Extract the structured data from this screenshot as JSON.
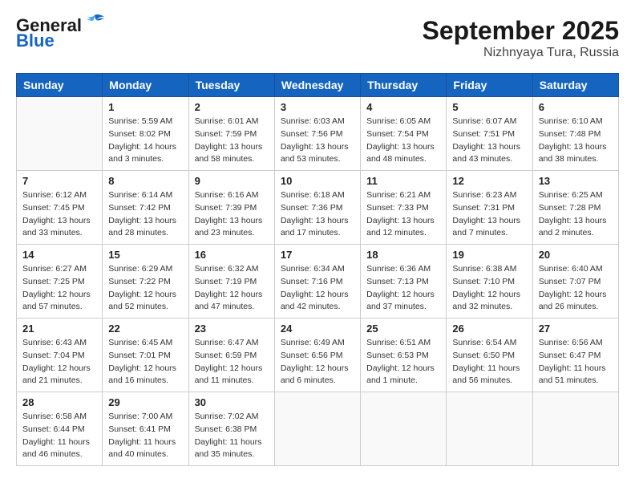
{
  "header": {
    "logo_line1": "General",
    "logo_line2": "Blue",
    "month": "September 2025",
    "location": "Nizhnyaya Tura, Russia"
  },
  "weekdays": [
    "Sunday",
    "Monday",
    "Tuesday",
    "Wednesday",
    "Thursday",
    "Friday",
    "Saturday"
  ],
  "weeks": [
    [
      {
        "day": "",
        "info": ""
      },
      {
        "day": "1",
        "info": "Sunrise: 5:59 AM\nSunset: 8:02 PM\nDaylight: 14 hours\nand 3 minutes."
      },
      {
        "day": "2",
        "info": "Sunrise: 6:01 AM\nSunset: 7:59 PM\nDaylight: 13 hours\nand 58 minutes."
      },
      {
        "day": "3",
        "info": "Sunrise: 6:03 AM\nSunset: 7:56 PM\nDaylight: 13 hours\nand 53 minutes."
      },
      {
        "day": "4",
        "info": "Sunrise: 6:05 AM\nSunset: 7:54 PM\nDaylight: 13 hours\nand 48 minutes."
      },
      {
        "day": "5",
        "info": "Sunrise: 6:07 AM\nSunset: 7:51 PM\nDaylight: 13 hours\nand 43 minutes."
      },
      {
        "day": "6",
        "info": "Sunrise: 6:10 AM\nSunset: 7:48 PM\nDaylight: 13 hours\nand 38 minutes."
      }
    ],
    [
      {
        "day": "7",
        "info": "Sunrise: 6:12 AM\nSunset: 7:45 PM\nDaylight: 13 hours\nand 33 minutes."
      },
      {
        "day": "8",
        "info": "Sunrise: 6:14 AM\nSunset: 7:42 PM\nDaylight: 13 hours\nand 28 minutes."
      },
      {
        "day": "9",
        "info": "Sunrise: 6:16 AM\nSunset: 7:39 PM\nDaylight: 13 hours\nand 23 minutes."
      },
      {
        "day": "10",
        "info": "Sunrise: 6:18 AM\nSunset: 7:36 PM\nDaylight: 13 hours\nand 17 minutes."
      },
      {
        "day": "11",
        "info": "Sunrise: 6:21 AM\nSunset: 7:33 PM\nDaylight: 13 hours\nand 12 minutes."
      },
      {
        "day": "12",
        "info": "Sunrise: 6:23 AM\nSunset: 7:31 PM\nDaylight: 13 hours\nand 7 minutes."
      },
      {
        "day": "13",
        "info": "Sunrise: 6:25 AM\nSunset: 7:28 PM\nDaylight: 13 hours\nand 2 minutes."
      }
    ],
    [
      {
        "day": "14",
        "info": "Sunrise: 6:27 AM\nSunset: 7:25 PM\nDaylight: 12 hours\nand 57 minutes."
      },
      {
        "day": "15",
        "info": "Sunrise: 6:29 AM\nSunset: 7:22 PM\nDaylight: 12 hours\nand 52 minutes."
      },
      {
        "day": "16",
        "info": "Sunrise: 6:32 AM\nSunset: 7:19 PM\nDaylight: 12 hours\nand 47 minutes."
      },
      {
        "day": "17",
        "info": "Sunrise: 6:34 AM\nSunset: 7:16 PM\nDaylight: 12 hours\nand 42 minutes."
      },
      {
        "day": "18",
        "info": "Sunrise: 6:36 AM\nSunset: 7:13 PM\nDaylight: 12 hours\nand 37 minutes."
      },
      {
        "day": "19",
        "info": "Sunrise: 6:38 AM\nSunset: 7:10 PM\nDaylight: 12 hours\nand 32 minutes."
      },
      {
        "day": "20",
        "info": "Sunrise: 6:40 AM\nSunset: 7:07 PM\nDaylight: 12 hours\nand 26 minutes."
      }
    ],
    [
      {
        "day": "21",
        "info": "Sunrise: 6:43 AM\nSunset: 7:04 PM\nDaylight: 12 hours\nand 21 minutes."
      },
      {
        "day": "22",
        "info": "Sunrise: 6:45 AM\nSunset: 7:01 PM\nDaylight: 12 hours\nand 16 minutes."
      },
      {
        "day": "23",
        "info": "Sunrise: 6:47 AM\nSunset: 6:59 PM\nDaylight: 12 hours\nand 11 minutes."
      },
      {
        "day": "24",
        "info": "Sunrise: 6:49 AM\nSunset: 6:56 PM\nDaylight: 12 hours\nand 6 minutes."
      },
      {
        "day": "25",
        "info": "Sunrise: 6:51 AM\nSunset: 6:53 PM\nDaylight: 12 hours\nand 1 minute."
      },
      {
        "day": "26",
        "info": "Sunrise: 6:54 AM\nSunset: 6:50 PM\nDaylight: 11 hours\nand 56 minutes."
      },
      {
        "day": "27",
        "info": "Sunrise: 6:56 AM\nSunset: 6:47 PM\nDaylight: 11 hours\nand 51 minutes."
      }
    ],
    [
      {
        "day": "28",
        "info": "Sunrise: 6:58 AM\nSunset: 6:44 PM\nDaylight: 11 hours\nand 46 minutes."
      },
      {
        "day": "29",
        "info": "Sunrise: 7:00 AM\nSunset: 6:41 PM\nDaylight: 11 hours\nand 40 minutes."
      },
      {
        "day": "30",
        "info": "Sunrise: 7:02 AM\nSunset: 6:38 PM\nDaylight: 11 hours\nand 35 minutes."
      },
      {
        "day": "",
        "info": ""
      },
      {
        "day": "",
        "info": ""
      },
      {
        "day": "",
        "info": ""
      },
      {
        "day": "",
        "info": ""
      }
    ]
  ]
}
